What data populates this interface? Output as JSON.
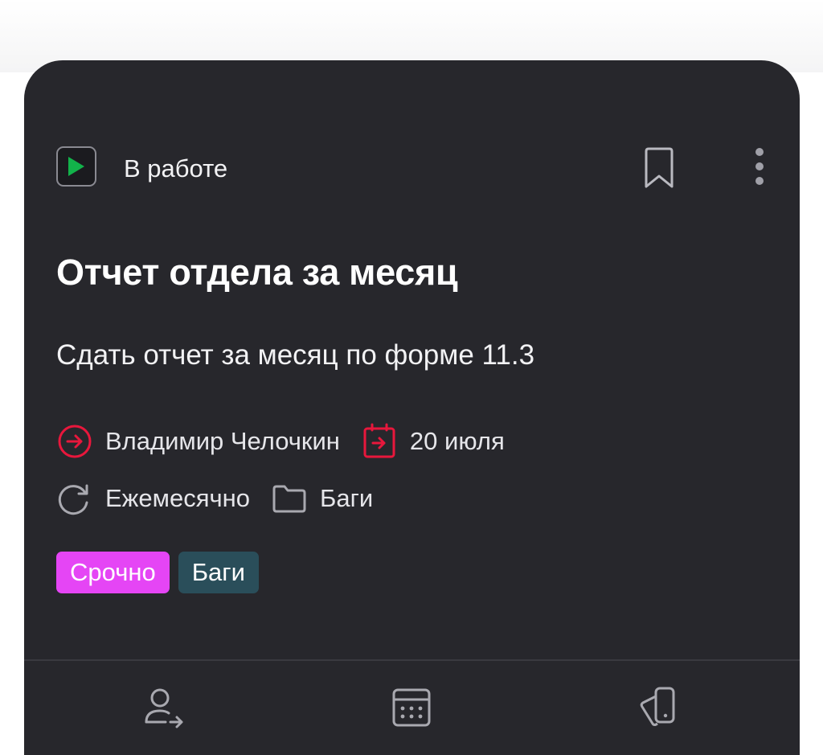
{
  "status": {
    "label": "В работе",
    "icon": "play-status-icon",
    "color": "#12b24a"
  },
  "header_actions": {
    "bookmark_icon": "bookmark-icon",
    "more_icon": "more-vertical-icon"
  },
  "task": {
    "title": "Отчет отдела за месяц",
    "description": "Сдать отчет за месяц по форме 11.3"
  },
  "meta": {
    "assignee": {
      "name": "Владимир Челочкин",
      "icon": "arrow-right-circle-icon",
      "color": "#e8173c"
    },
    "due_date": {
      "label": "20 июля",
      "icon": "calendar-arrow-icon",
      "color": "#e8173c"
    },
    "recurrence": {
      "label": "Ежемесячно",
      "icon": "repeat-icon"
    },
    "folder": {
      "label": "Баги",
      "icon": "folder-icon"
    }
  },
  "tags": [
    {
      "label": "Срочно",
      "color": "#e545f5"
    },
    {
      "label": "Баги",
      "color": "#2a4e5a"
    }
  ],
  "bottom_actions": [
    {
      "icon": "delegate-user-icon"
    },
    {
      "icon": "calendar-icon"
    },
    {
      "icon": "stack-cards-icon"
    }
  ]
}
